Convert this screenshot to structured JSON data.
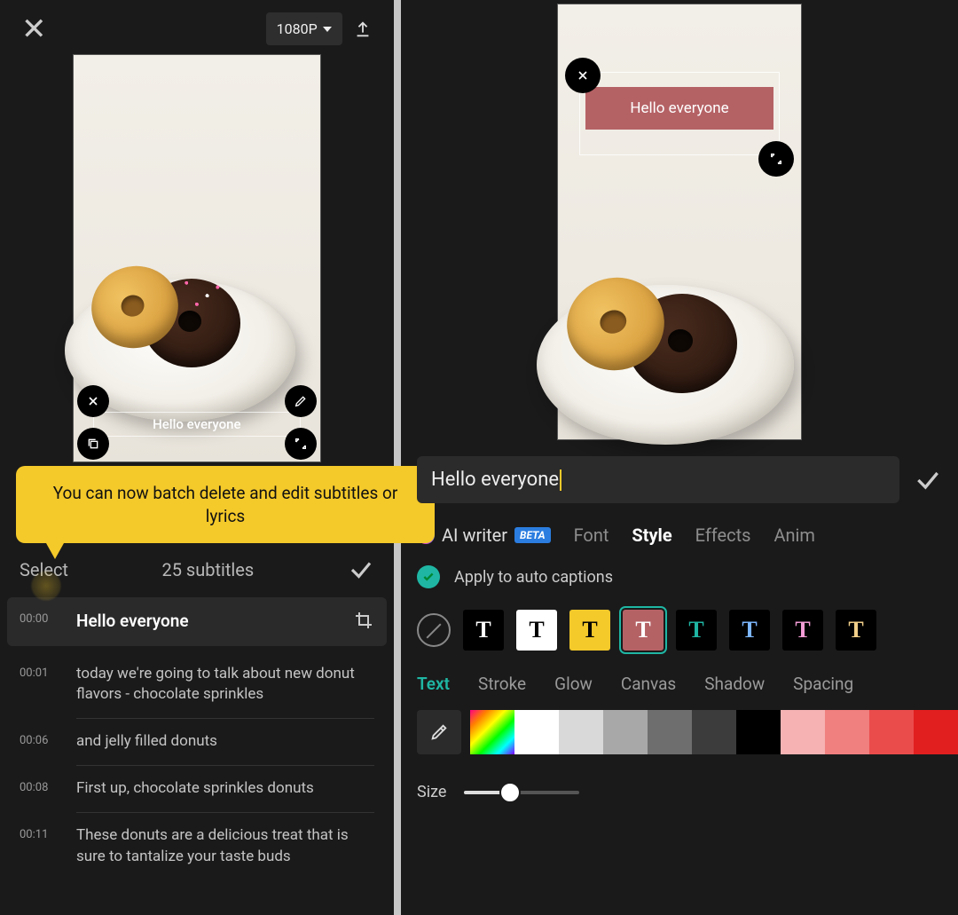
{
  "left": {
    "resolution": "1080P",
    "caption_text": "Hello everyone",
    "tooltip": "You can now batch delete and edit subtitles or lyrics",
    "select_label": "Select",
    "subtitle_count": "25 subtitles",
    "subs": [
      {
        "ts": "00:00",
        "text": "Hello everyone",
        "active": true
      },
      {
        "ts": "00:01",
        "text": "today we're going to talk about new donut flavors - chocolate sprinkles"
      },
      {
        "ts": "00:06",
        "text": "and jelly filled donuts"
      },
      {
        "ts": "00:08",
        "text": "First up, chocolate sprinkles donuts"
      },
      {
        "ts": "00:11",
        "text": "These donuts are a delicious treat that is sure to tantalize your taste buds"
      }
    ]
  },
  "right": {
    "overlay_text": "Hello everyone",
    "input_value": "Hello everyone",
    "tabs": {
      "ai": "AI writer",
      "beta": "BETA",
      "font": "Font",
      "style": "Style",
      "effects": "Effects",
      "anim": "Anim"
    },
    "apply_text": "Apply to auto captions",
    "subtabs": {
      "text": "Text",
      "stroke": "Stroke",
      "glow": "Glow",
      "canvas": "Canvas",
      "shadow": "Shadow",
      "spacing": "Spacing"
    },
    "presets": [
      {
        "bg": "#000000",
        "fg": "#ffffff"
      },
      {
        "bg": "#ffffff",
        "fg": "#000000"
      },
      {
        "bg": "#f4c92a",
        "fg": "#000000"
      },
      {
        "bg": "#b56265",
        "fg": "#ffffff",
        "selected": true
      },
      {
        "bg": "#000000",
        "fg": "#1fb6a4"
      },
      {
        "bg": "#000000",
        "fg": "#7db7ff"
      },
      {
        "bg": "#000000",
        "fg": "#f29bd4"
      },
      {
        "bg": "#000000",
        "fg": "#f2d08a"
      }
    ],
    "colors": [
      "#ffffff",
      "#d9d9d9",
      "#a8a8a8",
      "#6e6e6e",
      "#3c3c3c",
      "#000000",
      "#f6b2b2",
      "#f07f7f",
      "#ea4c4c",
      "#e21f1f"
    ],
    "size_label": "Size"
  }
}
